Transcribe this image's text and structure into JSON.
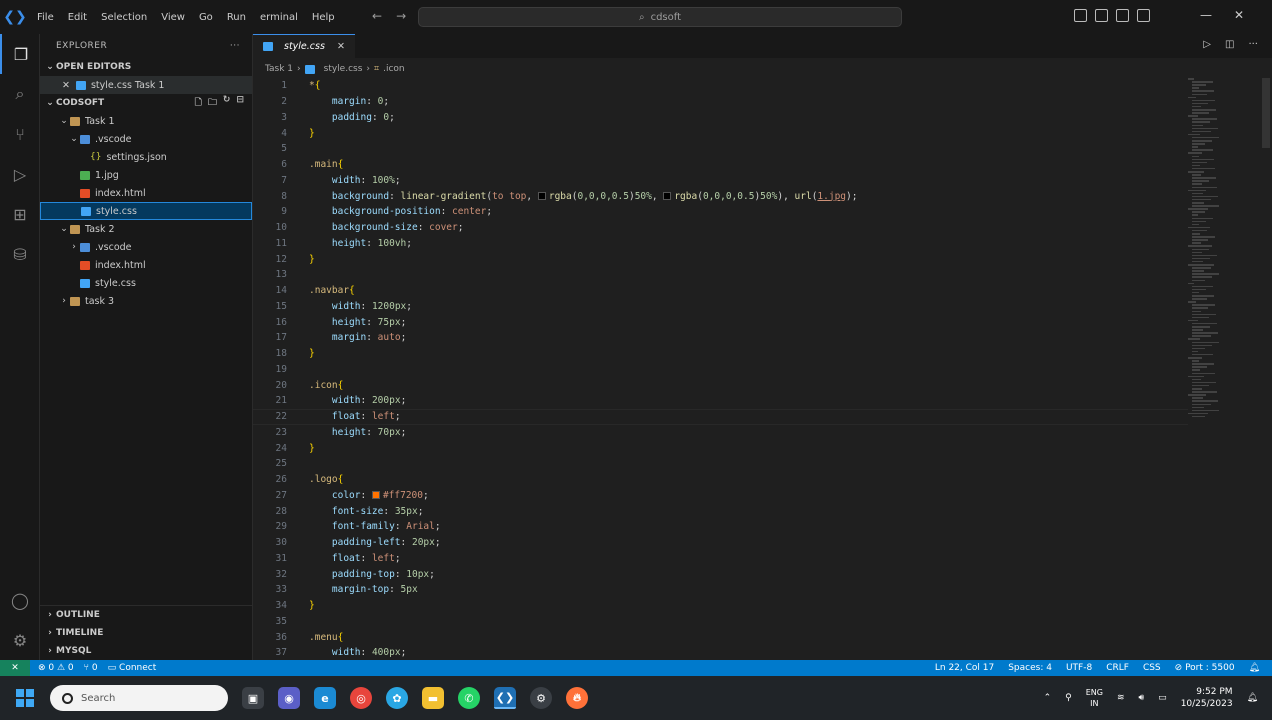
{
  "menu": [
    "File",
    "Edit",
    "Selection",
    "View",
    "Go",
    "Run",
    "erminal",
    "Help"
  ],
  "command_center": "cdsoft",
  "explorer": {
    "title": "EXPLORER",
    "open_editors_label": "OPEN EDITORS",
    "open_editor_item": "style.css Task 1",
    "workspace_label": "CODSOFT",
    "tree": [
      {
        "label": "Task 1",
        "kind": "folder",
        "depth": 1,
        "open": true
      },
      {
        "label": ".vscode",
        "kind": "folder-blue",
        "depth": 2,
        "open": true
      },
      {
        "label": "settings.json",
        "kind": "json",
        "depth": 3
      },
      {
        "label": "1.jpg",
        "kind": "img",
        "depth": 2
      },
      {
        "label": "index.html",
        "kind": "html",
        "depth": 2
      },
      {
        "label": "style.css",
        "kind": "css",
        "depth": 2,
        "selected": true
      },
      {
        "label": "Task 2",
        "kind": "folder",
        "depth": 1,
        "open": true
      },
      {
        "label": ".vscode",
        "kind": "folder-blue",
        "depth": 2,
        "open": false
      },
      {
        "label": "index.html",
        "kind": "html",
        "depth": 2
      },
      {
        "label": "style.css",
        "kind": "css",
        "depth": 2
      },
      {
        "label": "task 3",
        "kind": "folder",
        "depth": 1,
        "open": false
      }
    ],
    "bottom_sections": [
      "OUTLINE",
      "TIMELINE",
      "MYSQL"
    ]
  },
  "editor": {
    "tab_label": "style.css",
    "breadcrumb": [
      "Task 1",
      "style.css",
      ".icon"
    ],
    "lines": [
      {
        "n": "1",
        "html": "<span class='sel'>*</span><span class='brace'>{</span>"
      },
      {
        "n": "2",
        "html": "    <span class='prop'>margin</span>: <span class='num'>0</span>;"
      },
      {
        "n": "3",
        "html": "    <span class='prop'>padding</span>: <span class='num'>0</span>;"
      },
      {
        "n": "4",
        "html": "<span class='brace'>}</span>"
      },
      {
        "n": "5",
        "html": ""
      },
      {
        "n": "6",
        "html": "<span class='sel'>.main</span><span class='brace'>{</span>"
      },
      {
        "n": "7",
        "html": "    <span class='prop'>width</span>: <span class='num'>100%</span>;"
      },
      {
        "n": "8",
        "html": "    <span class='prop'>background</span>: <span class='fn'>linear-gradient</span>(<span class='val'>to top</span>, <span class='swatch' style='background:#000'></span><span class='fn'>rgba</span>(<span class='num'>0,0,0,0.5</span>)<span class='num'>50%</span>, <span class='swatch' style='background:#000'></span><span class='fn'>rgba</span>(<span class='num'>0,0,0,0.5</span>)<span class='num'>50%</span>), <span class='fn'>url</span>(<span class='link'>1.jpg</span>);"
      },
      {
        "n": "9",
        "html": "    <span class='prop'>background-position</span>: <span class='val'>center</span>;"
      },
      {
        "n": "10",
        "html": "    <span class='prop'>background-size</span>: <span class='val'>cover</span>;"
      },
      {
        "n": "11",
        "html": "    <span class='prop'>height</span>: <span class='num'>100vh</span>;"
      },
      {
        "n": "12",
        "html": "<span class='brace'>}</span>"
      },
      {
        "n": "13",
        "html": ""
      },
      {
        "n": "14",
        "html": "<span class='sel'>.navbar</span><span class='brace'>{</span>"
      },
      {
        "n": "15",
        "html": "    <span class='prop'>width</span>: <span class='num'>1200px</span>;"
      },
      {
        "n": "16",
        "html": "    <span class='prop'>height</span>: <span class='num'>75px</span>;"
      },
      {
        "n": "17",
        "html": "    <span class='prop'>margin</span>: <span class='val'>auto</span>;"
      },
      {
        "n": "18",
        "html": "<span class='brace'>}</span>"
      },
      {
        "n": "19",
        "html": ""
      },
      {
        "n": "20",
        "html": "<span class='sel'>.icon</span><span class='brace'>{</span>"
      },
      {
        "n": "21",
        "html": "    <span class='prop'>width</span>: <span class='num'>200px</span>;"
      },
      {
        "n": "22",
        "html": "    <span class='prop'>float</span>: <span class='val'>left</span>;",
        "current": true
      },
      {
        "n": "23",
        "html": "    <span class='prop'>height</span>: <span class='num'>70px</span>;"
      },
      {
        "n": "24",
        "html": "<span class='brace'>}</span>"
      },
      {
        "n": "25",
        "html": ""
      },
      {
        "n": "26",
        "html": "<span class='sel'>.logo</span><span class='brace'>{</span>"
      },
      {
        "n": "27",
        "html": "    <span class='prop'>color</span>: <span class='swatch' style='background:#ff7200'></span><span class='val'>#ff7200</span>;"
      },
      {
        "n": "28",
        "html": "    <span class='prop'>font-size</span>: <span class='num'>35px</span>;"
      },
      {
        "n": "29",
        "html": "    <span class='prop'>font-family</span>: <span class='val'>Arial</span>;"
      },
      {
        "n": "30",
        "html": "    <span class='prop'>padding-left</span>: <span class='num'>20px</span>;"
      },
      {
        "n": "31",
        "html": "    <span class='prop'>float</span>: <span class='val'>left</span>;"
      },
      {
        "n": "32",
        "html": "    <span class='prop'>padding-top</span>: <span class='num'>10px</span>;"
      },
      {
        "n": "33",
        "html": "    <span class='prop'>margin-top</span>: <span class='num'>5px</span>"
      },
      {
        "n": "34",
        "html": "<span class='brace'>}</span>"
      },
      {
        "n": "35",
        "html": ""
      },
      {
        "n": "36",
        "html": "<span class='sel'>.menu</span><span class='brace'>{</span>"
      },
      {
        "n": "37",
        "html": "    <span class='prop'>width</span>: <span class='num'>400px</span>;"
      }
    ]
  },
  "status": {
    "problems": "⊗ 0 ⚠ 0",
    "ports": "⑂ 0",
    "connect": "Connect",
    "position": "Ln 22, Col 17",
    "spaces": "Spaces: 4",
    "encoding": "UTF-8",
    "eol": "CRLF",
    "language": "CSS",
    "live": "Port : 5500"
  },
  "taskbar": {
    "search_placeholder": "Search",
    "lang_top": "ENG",
    "lang_bottom": "IN",
    "time": "9:52 PM",
    "date": "10/25/2023"
  },
  "colors": {
    "accent": "#007acc",
    "remote": "#16825d",
    "selection": "#04395e"
  }
}
